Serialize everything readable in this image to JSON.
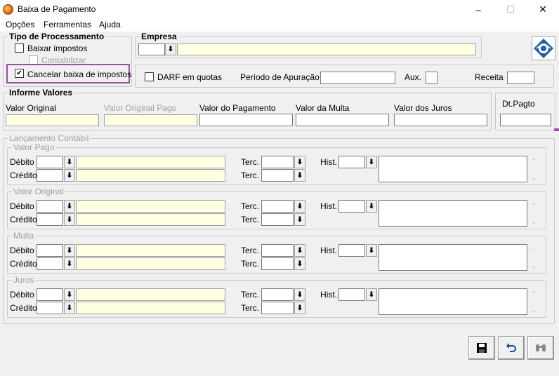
{
  "window": {
    "title": "Baixa de Pagamento",
    "minimize": "–",
    "maximize": "☐",
    "close": "✕"
  },
  "menu": [
    {
      "label": "Opções"
    },
    {
      "label": "Ferramentas"
    },
    {
      "label": "Ajuda"
    }
  ],
  "tipo": {
    "title": "Tipo de Processamento",
    "baixar": "Baixar impostos",
    "contabilizar": "Contabilizar",
    "cancelar": "Cancelar baixa de impostos",
    "cancelar_check": "✔"
  },
  "empresa": {
    "title": "Empresa",
    "code": "",
    "name": ""
  },
  "darf": {
    "label": "DARF em quotas",
    "periodo": "Período de Apuração",
    "aux": "Aux.",
    "receita": "Receita"
  },
  "valores": {
    "title": "Informe Valores",
    "original": "Valor Original",
    "original_pago": "Valor Original Pago",
    "pagamento": "Valor do Pagamento",
    "multa": "Valor da Multa",
    "juros": "Valor dos Juros"
  },
  "dtpagto": {
    "label": "Dt.Pagto"
  },
  "lanc": {
    "title": "Lançamento Contábil",
    "debito": "Débito",
    "credito": "Crédito",
    "terc": "Terc.",
    "hist": "Hist.",
    "groups": [
      {
        "title": "Valor Pago"
      },
      {
        "title": "Valor Original"
      },
      {
        "title": "Multa"
      },
      {
        "title": "Juros"
      }
    ]
  },
  "icons": {
    "arrow": "⬇",
    "scroll_up": "⌃",
    "scroll_down": "⌄",
    "save": "save-icon",
    "undo": "undo-icon",
    "search": "binoculars-icon"
  },
  "colors": {
    "highlight": "#9b4f9e",
    "field_yellow": "#ffffe1",
    "logo_blue": "#1f5fa8"
  }
}
